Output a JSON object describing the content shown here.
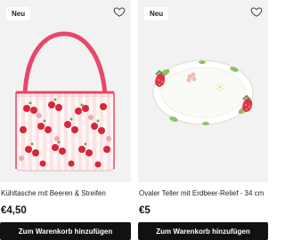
{
  "products": [
    {
      "badge": "Neu",
      "title": "Kühltasche mit Beeren & Streifen",
      "price": "€4,50",
      "cta": "Zum Warenkorb hinzufügen",
      "icon": "heart-outline-icon"
    },
    {
      "badge": "Neu",
      "title": "Ovaler Teller mit Erdbeer-Relief - 34 cm",
      "price": "€5",
      "cta": "Zum Warenkorb hinzufügen",
      "icon": "heart-outline-icon"
    }
  ],
  "colors": {
    "button_bg": "#111111",
    "image_bg": "#f2f2f2",
    "strap_pink": "#e8476a",
    "cherry_red": "#d8263a"
  }
}
